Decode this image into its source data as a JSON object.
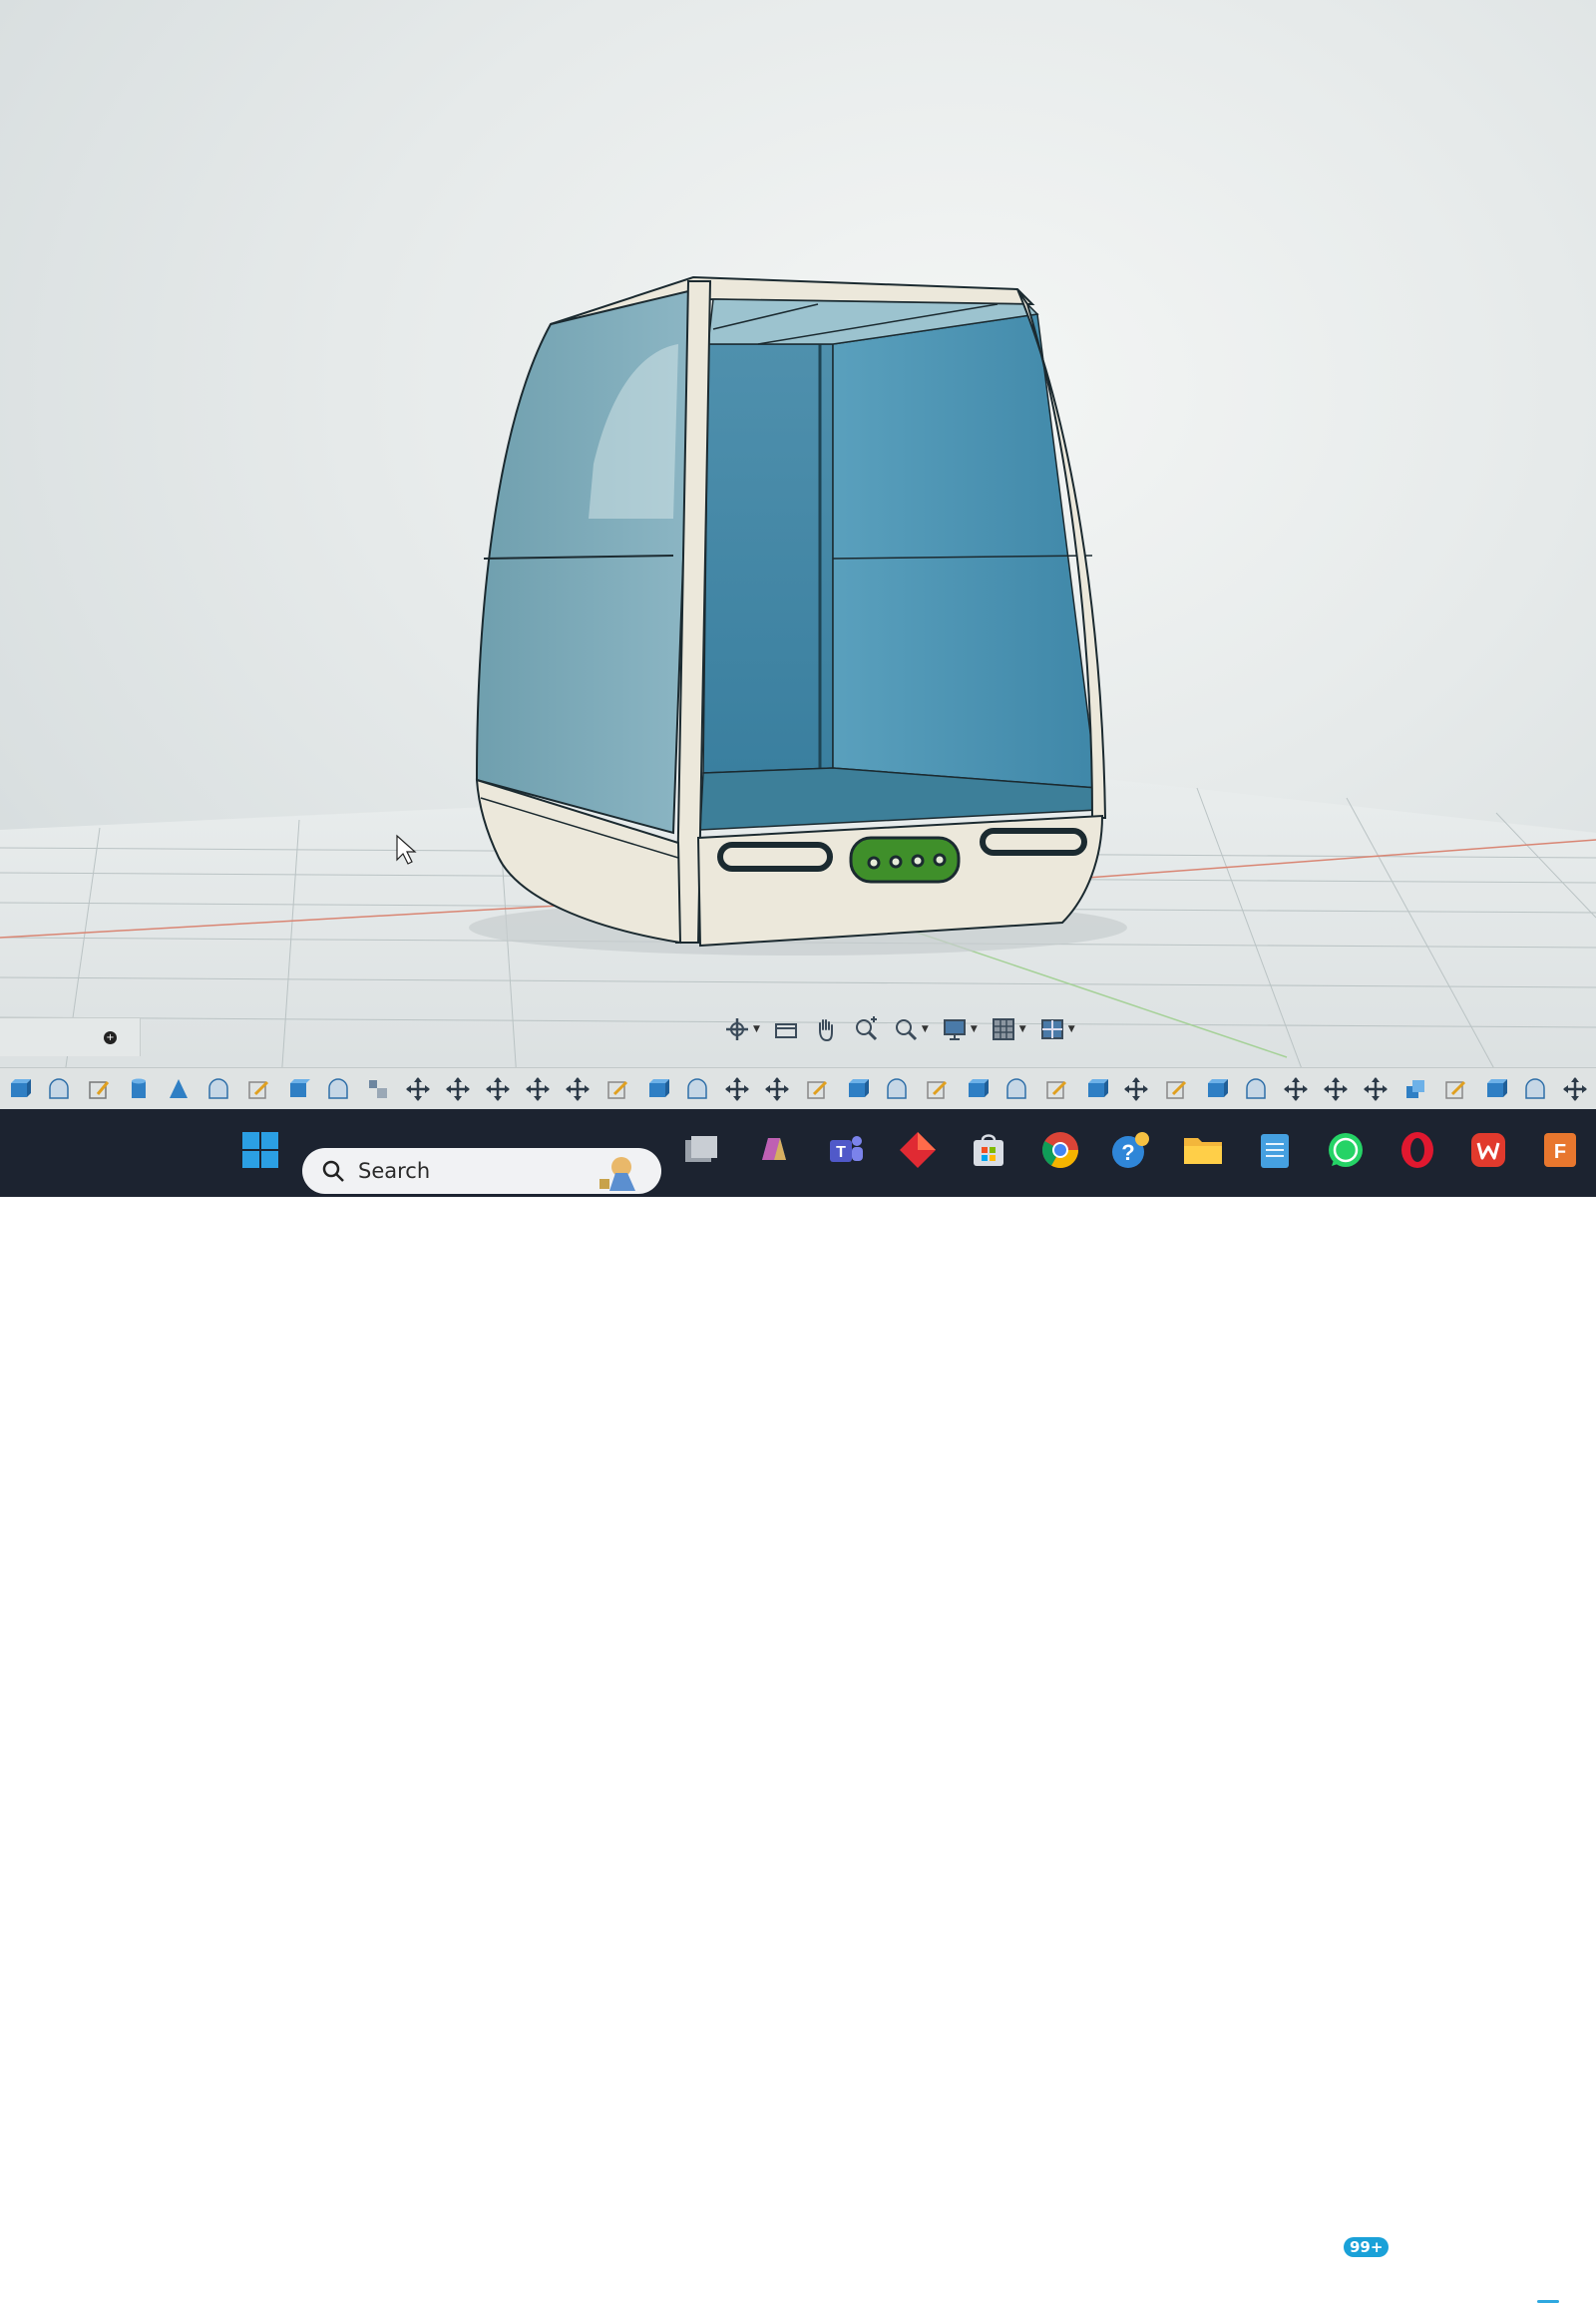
{
  "viewport": {
    "model_name": "enclosure-3d-model",
    "colors": {
      "glass": "#5f9fb6",
      "frame": "#ece8db",
      "accent_green": "#3f8f2a",
      "grid_line": "#b9c2c3",
      "axis_red": "#d87a6a",
      "axis_green": "#9bcf8d"
    }
  },
  "view_toolbar": {
    "items": [
      "orbit-icon",
      "view-box-icon",
      "pan-hand-icon",
      "zoom-in-icon",
      "zoom-window-icon",
      "display-style-icon",
      "grid-icon",
      "layout-icon"
    ]
  },
  "command_bar": {
    "icons": [
      "box-icon",
      "sphere-icon",
      "sketch-icon",
      "cylinder-icon",
      "cone-icon",
      "torus-icon",
      "sketch-edit-icon",
      "extrude-icon",
      "revolve-icon",
      "pattern-icon",
      "move-icon",
      "move-icon",
      "move-icon",
      "move-icon",
      "move-icon",
      "sketch-edit-icon",
      "box-icon",
      "revolve-icon",
      "move-icon",
      "move-icon",
      "sketch-edit-icon",
      "box-icon",
      "revolve-icon",
      "sketch-edit-icon",
      "box-icon",
      "revolve-icon",
      "sketch-edit-icon",
      "box-icon",
      "move-icon",
      "sketch-edit-icon",
      "box-icon",
      "revolve-icon",
      "move-icon",
      "move-icon",
      "move-icon",
      "combine-icon",
      "sketch-edit-icon",
      "box-icon",
      "revolve-icon",
      "move-icon"
    ]
  },
  "taskbar": {
    "search_label": "Search",
    "notification_badge": "99+",
    "apps": [
      "windows-start-icon",
      "task-view-icon",
      "copilot-icon",
      "teams-icon",
      "diamond-app-icon",
      "store-icon",
      "chrome-icon",
      "help-icon",
      "file-explorer-icon",
      "notepad-icon",
      "whatsapp-icon",
      "opera-icon",
      "wps-office-icon",
      "fusion-app-icon"
    ],
    "app_label_f": "F"
  }
}
